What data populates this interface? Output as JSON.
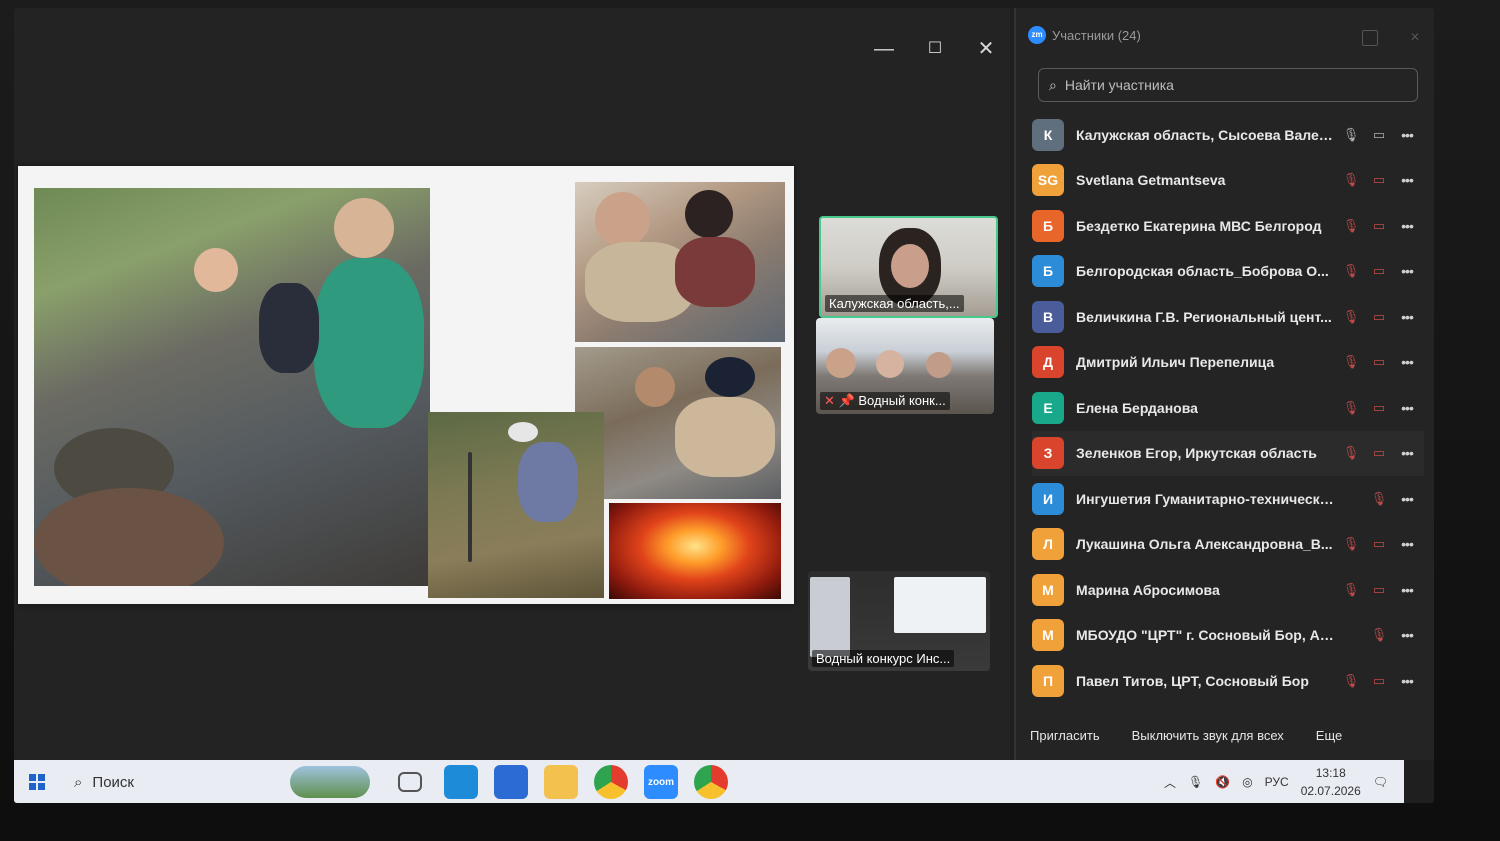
{
  "window": {
    "minimize": "—",
    "maximize": "☐",
    "close": "✕"
  },
  "video_tiles": [
    {
      "label": "Калужская область,..."
    },
    {
      "label": "Водный конк..."
    },
    {
      "label": "Водный конкурс Инс..."
    }
  ],
  "panel": {
    "title": "Участники (24)",
    "search_placeholder": "Найти участника",
    "participants": [
      {
        "initial": "К",
        "color": "#5f6f7d",
        "name": "Калужская область, Сысоева Валер...",
        "mic": "on",
        "cam": "on"
      },
      {
        "initial": "SG",
        "color": "#f0a13a",
        "name": "Svetlana Getmantseva",
        "mic": "off",
        "cam": "off"
      },
      {
        "initial": "Б",
        "color": "#e8662a",
        "name": "Бездетко Екатерина МВС Белгород",
        "mic": "off",
        "cam": "off"
      },
      {
        "initial": "Б",
        "color": "#2d8cd8",
        "name": "Белгородская область_Боброва О...",
        "mic": "off",
        "cam": "off"
      },
      {
        "initial": "В",
        "color": "#4a5c9a",
        "name": "Величкина Г.В. Региональный цент...",
        "mic": "off",
        "cam": "off"
      },
      {
        "initial": "Д",
        "color": "#d9442c",
        "name": "Дмитрий Ильич Перепелица",
        "mic": "off",
        "cam": "off"
      },
      {
        "initial": "Е",
        "color": "#1aa88a",
        "name": "Елена Берданова",
        "mic": "off",
        "cam": "off"
      },
      {
        "initial": "З",
        "color": "#d9442c",
        "name": "Зеленков Егор, Иркутская область",
        "mic": "off",
        "cam": "off"
      },
      {
        "initial": "И",
        "color": "#2d8cd8",
        "name": "Ингушетия Гуманитарно-технический к...",
        "mic": "off",
        "cam": "none"
      },
      {
        "initial": "Л",
        "color": "#f0a13a",
        "name": "Лукашина Ольга Александровна_В...",
        "mic": "off",
        "cam": "off"
      },
      {
        "initial": "М",
        "color": "#f0a13a",
        "name": "Марина Абросимова",
        "mic": "off",
        "cam": "off"
      },
      {
        "initial": "М",
        "color": "#f0a13a",
        "name": "МБОУДО \"ЦРТ\" г. Сосновый Бор, Анна ...",
        "mic": "off",
        "cam": "none"
      },
      {
        "initial": "П",
        "color": "#f0a13a",
        "name": "Павел Титов, ЦРТ, Сосновый Бор",
        "mic": "off",
        "cam": "off"
      }
    ],
    "footer": {
      "invite": "Пригласить",
      "mute_all": "Выключить звук для всех",
      "more": "Еще"
    }
  },
  "taskbar": {
    "search_label": "Поиск",
    "apps": [
      {
        "name": "task-view",
        "color": "#e9edf3",
        "label": ""
      },
      {
        "name": "edge",
        "color": "#1e8bd8",
        "label": ""
      },
      {
        "name": "store",
        "color": "#2b6bd3",
        "label": ""
      },
      {
        "name": "explorer",
        "color": "#f2c14e",
        "label": ""
      },
      {
        "name": "chrome",
        "color": "#e3e3e3",
        "label": ""
      },
      {
        "name": "zoom",
        "color": "#2d8cff",
        "label": "zoom"
      },
      {
        "name": "chrome-profile",
        "color": "#e3e3e3",
        "label": ""
      }
    ],
    "lang": "РУС",
    "time": "13:18",
    "date": "02.07.2026"
  }
}
